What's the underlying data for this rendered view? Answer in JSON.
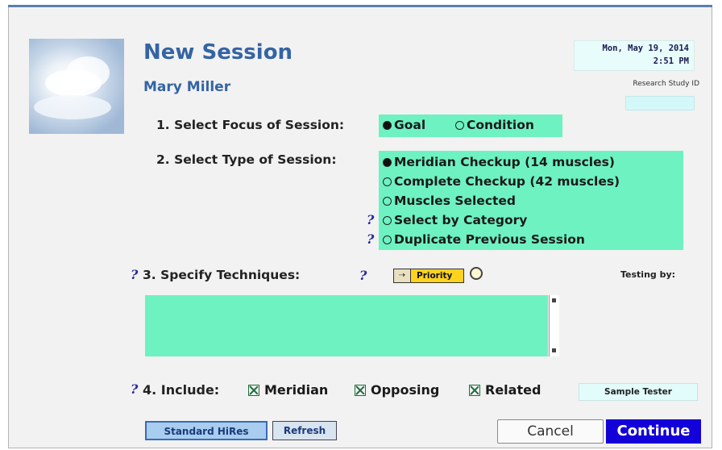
{
  "header": {
    "title": "New Session",
    "patient_name": "Mary Miller"
  },
  "datetime": {
    "date": "Mon, May 19, 2014",
    "time": "2:51 PM"
  },
  "research": {
    "label": "Research Study ID",
    "value": ""
  },
  "step1": {
    "label": "1. Select Focus of Session:",
    "options": [
      {
        "label": "Goal",
        "selected": true
      },
      {
        "label": "Condition",
        "selected": false
      }
    ]
  },
  "step2": {
    "label": "2. Select Type of Session:",
    "options": [
      {
        "label": "Meridian Checkup (14 muscles)",
        "selected": true
      },
      {
        "label": "Complete Checkup (42 muscles)",
        "selected": false
      },
      {
        "label": "Muscles Selected",
        "selected": false
      },
      {
        "label": "Select by Category",
        "selected": false
      },
      {
        "label": "Duplicate Previous Session",
        "selected": false
      }
    ]
  },
  "help_icon": "?",
  "step3": {
    "label": "3. Specify Techniques:",
    "priority_label": "Priority",
    "testing_label": "Testing by:"
  },
  "step4": {
    "label": "4. Include:",
    "items": [
      {
        "label": "Meridian",
        "checked": true
      },
      {
        "label": "Opposing",
        "checked": true
      },
      {
        "label": "Related",
        "checked": true
      }
    ]
  },
  "tester": "Sample Tester",
  "buttons": {
    "standard": "Standard HiRes",
    "refresh": "Refresh",
    "cancel": "Cancel",
    "continue": "Continue"
  },
  "colors": {
    "title": "#3464a4",
    "green_panel": "#6ef2c2",
    "continue_bg": "#1400d8",
    "priority_bg": "#ffd21e"
  }
}
